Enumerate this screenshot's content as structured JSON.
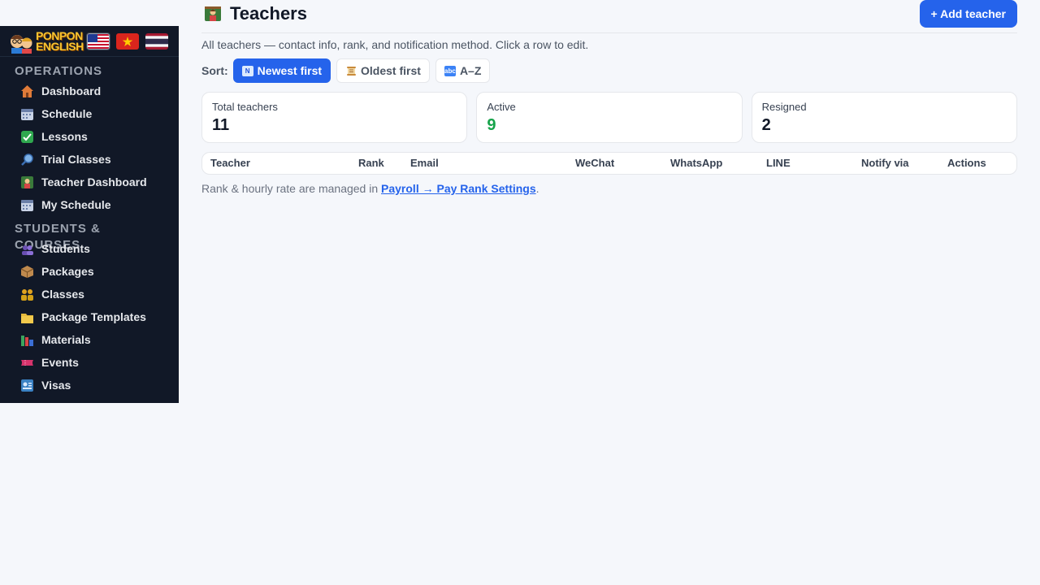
{
  "brand": {
    "line1": "PONPON",
    "line2": "ENGLISH"
  },
  "sidebar": {
    "sections": [
      {
        "label": "OPERATIONS",
        "items": [
          {
            "label": "Dashboard",
            "icon": "house-icon"
          },
          {
            "label": "Schedule",
            "icon": "calendar-icon"
          },
          {
            "label": "Lessons",
            "icon": "checkmark-icon"
          },
          {
            "label": "Trial Classes",
            "icon": "magnifier-icon"
          },
          {
            "label": "Teacher Dashboard",
            "icon": "teacher-icon"
          },
          {
            "label": "My Schedule",
            "icon": "calendar-icon"
          }
        ]
      },
      {
        "label": "STUDENTS & COURSES",
        "items": [
          {
            "label": "Students",
            "icon": "people-icon"
          },
          {
            "label": "Packages",
            "icon": "package-icon"
          },
          {
            "label": "Classes",
            "icon": "group-icon"
          },
          {
            "label": "Package Templates",
            "icon": "folder-icon"
          },
          {
            "label": "Materials",
            "icon": "books-icon"
          },
          {
            "label": "Events",
            "icon": "ticket-icon"
          },
          {
            "label": "Visas",
            "icon": "passport-icon"
          }
        ]
      }
    ]
  },
  "header": {
    "title": "Teachers",
    "add_button": "+ Add teacher",
    "subtitle": "All teachers — contact info, rank, and notification method. Click a row to edit."
  },
  "sort": {
    "label": "Sort:",
    "options": [
      {
        "label": "Newest first",
        "icon": "new-badge-icon",
        "active": true
      },
      {
        "label": "Oldest first",
        "icon": "scroll-icon",
        "active": false
      },
      {
        "label": "A–Z",
        "icon": "abc-icon",
        "active": false
      }
    ]
  },
  "stats": [
    {
      "label": "Total teachers",
      "value": "11"
    },
    {
      "label": "Active",
      "value": "9"
    },
    {
      "label": "Resigned",
      "value": "2"
    }
  ],
  "table": {
    "columns": [
      "Teacher",
      "Rank",
      "Email",
      "WeChat",
      "WhatsApp",
      "LINE",
      "Notify via",
      "Actions"
    ],
    "rows": []
  },
  "note": {
    "prefix": "Rank & hourly rate are managed in ",
    "link": "Payroll → Pay Rank Settings",
    "suffix": "."
  },
  "colors": {
    "primary": "#2563eb",
    "sidebar": "#111827",
    "active_green": "#16a34a"
  }
}
